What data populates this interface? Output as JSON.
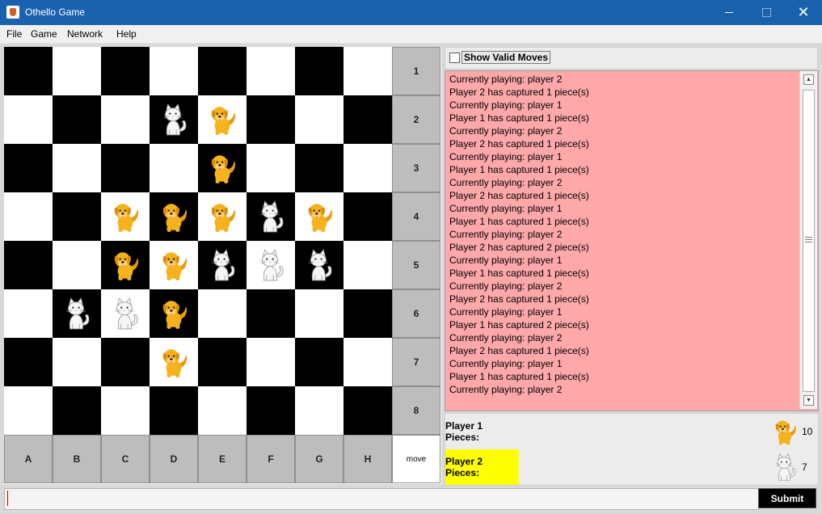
{
  "window": {
    "title": "Othello Game",
    "controls": {
      "minimize": "minimize",
      "maximize": "maximize",
      "close": "close"
    }
  },
  "menu": [
    "File",
    "Game",
    "Network",
    "Help"
  ],
  "board": {
    "columns": [
      "A",
      "B",
      "C",
      "D",
      "E",
      "F",
      "G",
      "H"
    ],
    "rows": [
      "1",
      "2",
      "3",
      "4",
      "5",
      "6",
      "7",
      "8"
    ],
    "corner_label": "move",
    "grid": [
      [
        "",
        "",
        "",
        "",
        "",
        "",
        "",
        ""
      ],
      [
        "",
        "",
        "",
        "cat",
        "dog",
        "",
        "",
        ""
      ],
      [
        "",
        "",
        "",
        "",
        "dog",
        "",
        "",
        ""
      ],
      [
        "",
        "",
        "dog",
        "dog",
        "dog",
        "cat",
        "dog",
        ""
      ],
      [
        "",
        "",
        "dog",
        "dog",
        "cat",
        "cat",
        "cat",
        ""
      ],
      [
        "",
        "cat",
        "cat",
        "dog",
        "",
        "",
        "",
        ""
      ],
      [
        "",
        "",
        "",
        "dog",
        "",
        "",
        "",
        ""
      ],
      [
        "",
        "",
        "",
        "",
        "",
        "",
        "",
        ""
      ]
    ],
    "piece_icons": {
      "dog": "dog-piece-icon",
      "cat": "cat-piece-icon"
    },
    "colors": {
      "dark_square": "#000000",
      "light_square": "#ffffff",
      "label_bg": "#bdbdbd"
    }
  },
  "show_valid_moves": {
    "label": "Show Valid Moves",
    "checked": false
  },
  "log": {
    "background": "#ffa8aa",
    "lines": [
      "Currently playing: player 2",
      "Player 2 has captured 1 piece(s)",
      "Currently playing: player 1",
      "Player 1 has captured 1 piece(s)",
      "Currently playing: player 2",
      "Player 2 has captured 1 piece(s)",
      "Currently playing: player 1",
      "Player 1 has captured 1 piece(s)",
      "Currently playing: player 2",
      "Player 2 has captured 1 piece(s)",
      "Currently playing: player 1",
      "Player 1 has captured 1 piece(s)",
      "Currently playing: player 2",
      "Player 2 has captured 2 piece(s)",
      "Currently playing: player 1",
      "Player 1 has captured 1 piece(s)",
      "Currently playing: player 2",
      "Player 2 has captured 1 piece(s)",
      "Currently playing: player 1",
      "Player 1 has captured 2 piece(s)",
      "Currently playing: player 2",
      "Player 2 has captured 1 piece(s)",
      "Currently playing: player 1",
      "Player 1 has captured 1 piece(s)",
      "Currently playing: player 2"
    ]
  },
  "score": {
    "player1": {
      "label": "Player 1 Pieces:",
      "count": "10",
      "icon": "dog-piece-icon"
    },
    "player2": {
      "label": "Player 2 Pieces:",
      "count": "7",
      "icon": "cat-piece-icon",
      "highlight": "#ffff00"
    }
  },
  "input": {
    "value": "",
    "submit_label": "Submit"
  }
}
